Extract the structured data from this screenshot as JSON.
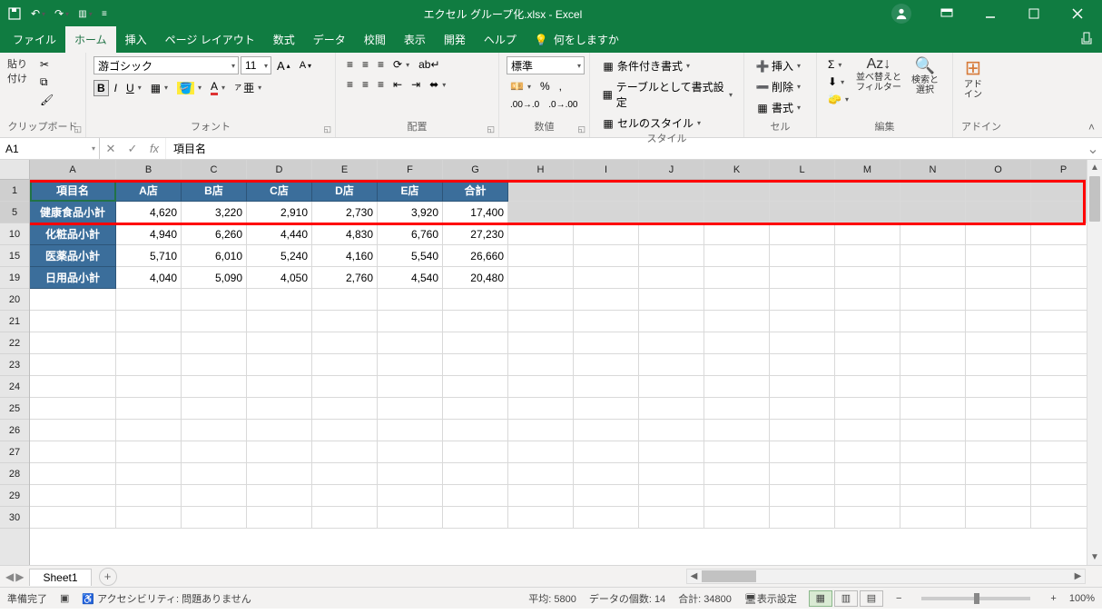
{
  "title": "エクセル グループ化.xlsx  -  Excel",
  "tabs": [
    "ファイル",
    "ホーム",
    "挿入",
    "ページ レイアウト",
    "数式",
    "データ",
    "校閲",
    "表示",
    "開発",
    "ヘルプ"
  ],
  "active_tab": 1,
  "tell_me": "何をしますか",
  "namebox": "A1",
  "formula": "項目名",
  "font": {
    "name": "游ゴシック",
    "size": "11"
  },
  "number_format": "標準",
  "ribbon_groups": {
    "clipboard": "クリップボード",
    "font": "フォント",
    "align": "配置",
    "number": "数値",
    "styles": "スタイル",
    "cells": "セル",
    "editing": "編集",
    "addins": "アドイン"
  },
  "paste_label": "貼り付け",
  "styles": {
    "cond": "条件付き書式",
    "tablefmt": "テーブルとして書式設定",
    "cellstyle": "セルのスタイル"
  },
  "cells": {
    "insert": "挿入",
    "delete": "削除",
    "format": "書式"
  },
  "editing": {
    "sort": "並べ替えと\nフィルター",
    "find": "検索と\n選択"
  },
  "addins_label": "アド\nイン",
  "columns": [
    "A",
    "B",
    "C",
    "D",
    "E",
    "F",
    "G",
    "H",
    "I",
    "J",
    "K",
    "L",
    "M",
    "N",
    "O",
    "P"
  ],
  "sel_cols": [
    "A",
    "B",
    "C",
    "D",
    "E",
    "F",
    "G",
    "H",
    "I",
    "J",
    "K",
    "L",
    "M",
    "N",
    "O",
    "P"
  ],
  "row_numbers": [
    "1",
    "5",
    "10",
    "15",
    "19",
    "20",
    "21",
    "22",
    "23",
    "24",
    "25",
    "26",
    "27",
    "28",
    "29",
    "30"
  ],
  "sel_rows": [
    "1",
    "5"
  ],
  "header_row": [
    "項目名",
    "A店",
    "B店",
    "C店",
    "D店",
    "E店",
    "合計"
  ],
  "data_rows": [
    {
      "label": "健康食品小計",
      "vals": [
        "4,620",
        "3,220",
        "2,910",
        "2,730",
        "3,920",
        "17,400"
      ]
    },
    {
      "label": "化粧品小計",
      "vals": [
        "4,940",
        "6,260",
        "4,440",
        "4,830",
        "6,760",
        "27,230"
      ]
    },
    {
      "label": "医薬品小計",
      "vals": [
        "5,710",
        "6,010",
        "5,240",
        "4,160",
        "5,540",
        "26,660"
      ]
    },
    {
      "label": "日用品小計",
      "vals": [
        "4,040",
        "5,090",
        "4,050",
        "2,760",
        "4,540",
        "20,480"
      ]
    }
  ],
  "sheet_name": "Sheet1",
  "status": {
    "ready": "準備完了",
    "acc": "アクセシビリティ: 問題ありません",
    "avg": "平均: 5800",
    "count": "データの個数: 14",
    "sum": "合計: 34800",
    "display": "表示設定",
    "zoom": "100%"
  }
}
